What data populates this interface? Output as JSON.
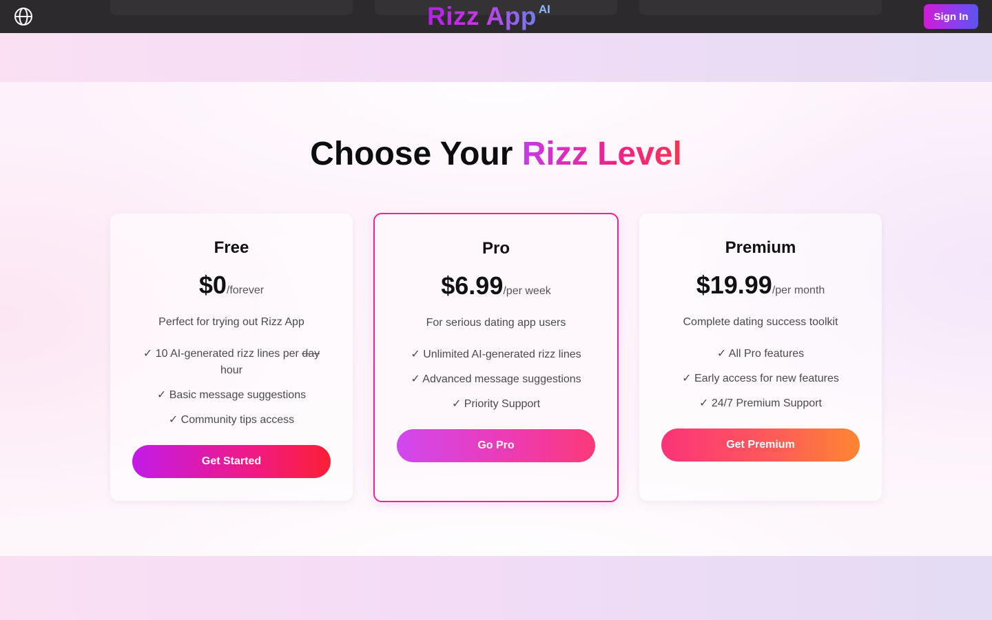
{
  "header": {
    "logo_text": "Rizz App",
    "logo_sup": "AI",
    "signin_label": "Sign In",
    "icons": {
      "language": "globe-icon"
    }
  },
  "pricing": {
    "heading_prefix": "Choose Your ",
    "heading_highlight": "Rizz Level",
    "plans": [
      {
        "name": "Free",
        "price": "$0",
        "period": "/forever",
        "description": "Perfect for trying out Rizz App",
        "features": [
          {
            "pre": "✓ 10 AI-generated rizz lines per ",
            "strike": "day",
            "post": " hour"
          },
          {
            "text": "✓ Basic message suggestions"
          },
          {
            "text": "✓ Community tips access"
          }
        ],
        "cta": "Get Started"
      },
      {
        "name": "Pro",
        "price": "$6.99",
        "period": "/per week",
        "description": "For serious dating app users",
        "features": [
          {
            "text": "✓ Unlimited AI-generated rizz lines"
          },
          {
            "text": "✓ Advanced message suggestions"
          },
          {
            "text": "✓ Priority Support"
          }
        ],
        "cta": "Go Pro"
      },
      {
        "name": "Premium",
        "price": "$19.99",
        "period": "/per month",
        "description": "Complete dating success toolkit",
        "features": [
          {
            "text": "✓ All Pro features"
          },
          {
            "text": "✓ Early access for new features"
          },
          {
            "text": "✓ 24/7 Premium Support"
          }
        ],
        "cta": "Get Premium"
      }
    ]
  },
  "colors": {
    "header_bg": "#2d2a2e",
    "featured_border": "#f0209a",
    "accent_pink": "#f0208f",
    "accent_purple": "#c43be8"
  }
}
